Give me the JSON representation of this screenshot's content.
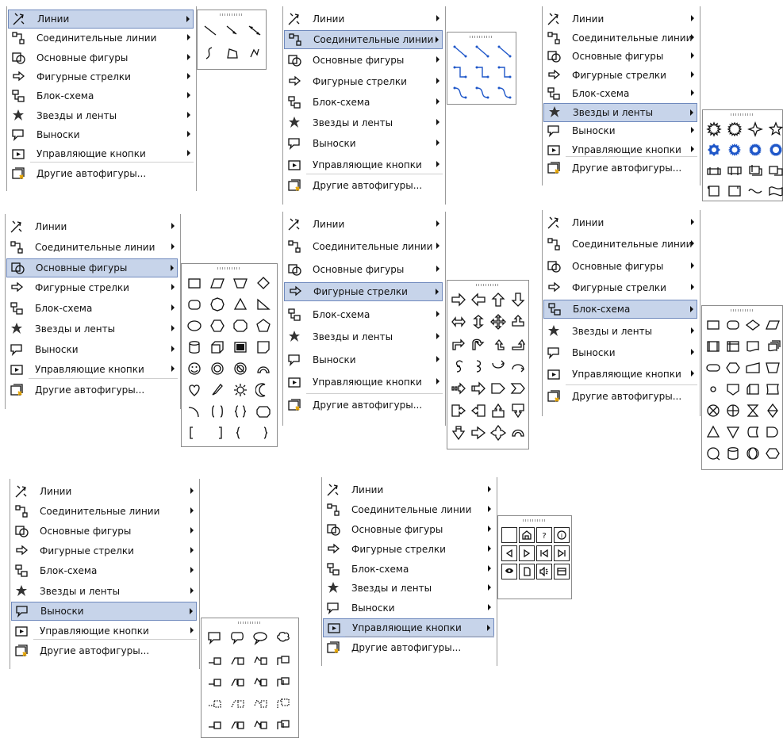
{
  "menu_labels": [
    "Линии",
    "Соединительные линии",
    "Основные фигуры",
    "Фигурные стрелки",
    "Блок-схема",
    "Звезды и ленты",
    "Выноски",
    "Управляющие кнопки",
    "Другие автофигуры..."
  ],
  "menu_icons": [
    "lines-icon",
    "connector-icon",
    "basic-shapes-icon",
    "block-arrows-icon",
    "flowchart-icon",
    "stars-banners-icon",
    "callouts-icon",
    "action-buttons-icon",
    "more-autoshapes-icon"
  ],
  "selected_items": [
    "Линии",
    "Соединительные линии",
    "Звезды и ленты",
    "Основные фигуры",
    "Фигурные стрелки",
    "Блок-схема",
    "Выноски",
    "Управляющие кнопки"
  ],
  "colors": {
    "selection_bg": "#c7d4ea",
    "selection_border": "#6f89bd",
    "border": "#9a9a9a",
    "connector_blue": "#1f57c9"
  }
}
